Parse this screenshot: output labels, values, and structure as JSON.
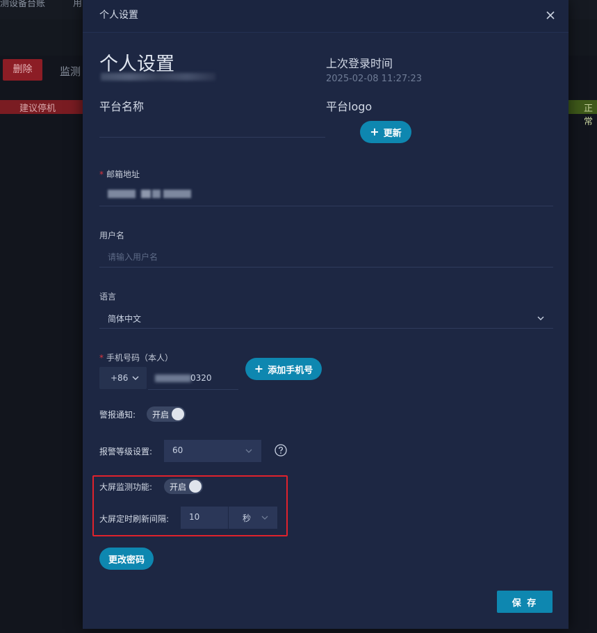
{
  "background": {
    "nav_left": "测设备台账",
    "nav_right": "用",
    "delete_button": "删除",
    "monitor_text": "监测",
    "status_stop": "建议停机",
    "status_normal": "正常"
  },
  "modal": {
    "header_title": "个人设置",
    "close_icon": "close-icon",
    "page_title": "个人设置",
    "last_login_label": "上次登录时间",
    "last_login_value": "2025-02-08 11:27:23",
    "platform_name_label": "平台名称",
    "platform_logo_label": "平台logo",
    "update_button": "更新",
    "email": {
      "label": "邮箱地址",
      "required": "*"
    },
    "username": {
      "label": "用户名",
      "placeholder": "请输入用户名"
    },
    "language": {
      "label": "语言",
      "value": "简体中文"
    },
    "phone": {
      "label": "手机号码（本人）",
      "required": "*",
      "country_code": "+86",
      "number_tail": "0320",
      "add_button": "添加手机号"
    },
    "alarm_notify": {
      "label": "警报通知:",
      "toggle_text": "开启",
      "on": true
    },
    "alarm_level": {
      "label": "报警等级设置:",
      "value": "60",
      "help_icon": "question-circle-icon"
    },
    "screen_monitor": {
      "label": "大屏监测功能:",
      "toggle_text": "开启",
      "on": true
    },
    "screen_refresh": {
      "label": "大屏定时刷新间隔:",
      "value": "10",
      "unit": "秒"
    },
    "change_password_button": "更改密码",
    "save_button": "保 存"
  },
  "colors": {
    "modal_bg": "#1d2743",
    "accent": "#0e87b0",
    "highlight": "#e0222c",
    "required": "#d9363e"
  }
}
